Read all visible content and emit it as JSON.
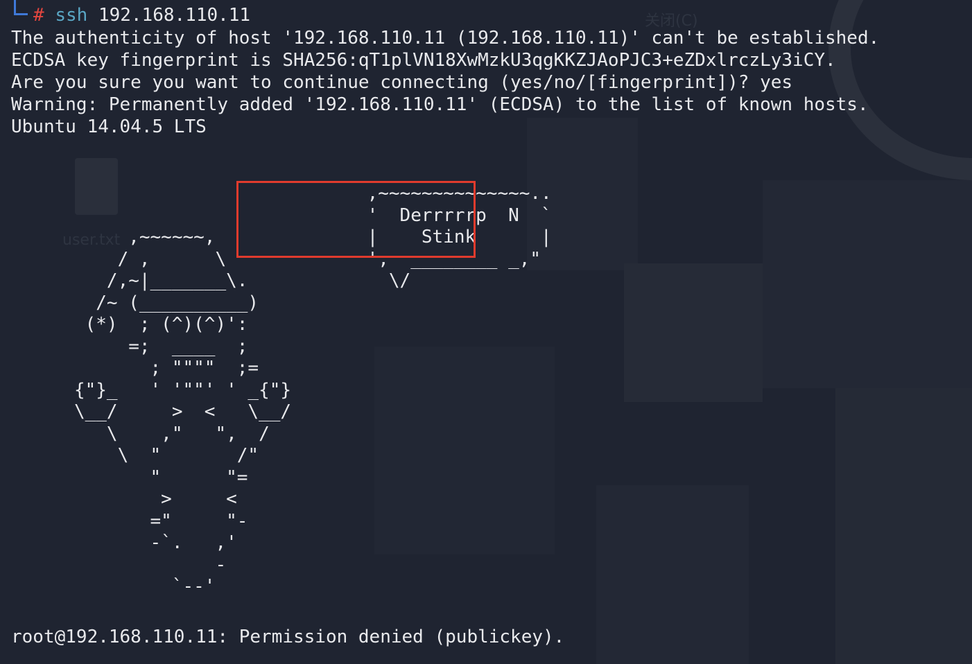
{
  "prompt": {
    "symbol": "#",
    "command": "ssh",
    "argument": "192.168.110.11"
  },
  "output": [
    "The authenticity of host '192.168.110.11 (192.168.110.11)' can't be established.",
    "ECDSA key fingerprint is SHA256:qT1plVN18XwMzkU3qgKKZJAoPJC3+eZDxlrczLy3iCY.",
    "Are you sure you want to continue connecting (yes/no/[fingerprint])? yes",
    "Warning: Permanently added '192.168.110.11' (ECDSA) to the list of known hosts.",
    "Ubuntu 14.04.5 LTS"
  ],
  "ascii_art": "                              ,~~~~~~~~~~~~~~..\n                              '  Derrrrrp  N  `\n        ,~~~~~~,              |    Stink      |\n       / ,      \\             ',  ________ _,\"\n      /,~|_______\\.             \\/\n     /~ (__________)\n    (*)  ; (^)(^)':\n        =;  ____  ;\n          ; \"\"\"\"  ;=\n   {\"}_   ' '\"\"' ' _{\"}\n   \\__/     >  <   \\__/\n      \\    ,\"   \",  /\n       \\  \"       /\"\n          \"      \"=\n           >     <\n          =\"     \"-\n          -`.   ,'\n                -\n            `--'",
  "final_line": "root@192.168.110.11: Permission denied (publickey).",
  "background_ghost": {
    "file_label": "user.txt",
    "menu_label": "关闭(C)"
  },
  "colors": {
    "background": "#1f2431",
    "text": "#e8e9ec",
    "prompt_hash": "#e2463f",
    "command": "#5aa6c4",
    "prompt_frame": "#3f79d8",
    "highlight_box": "#e03b2d"
  }
}
